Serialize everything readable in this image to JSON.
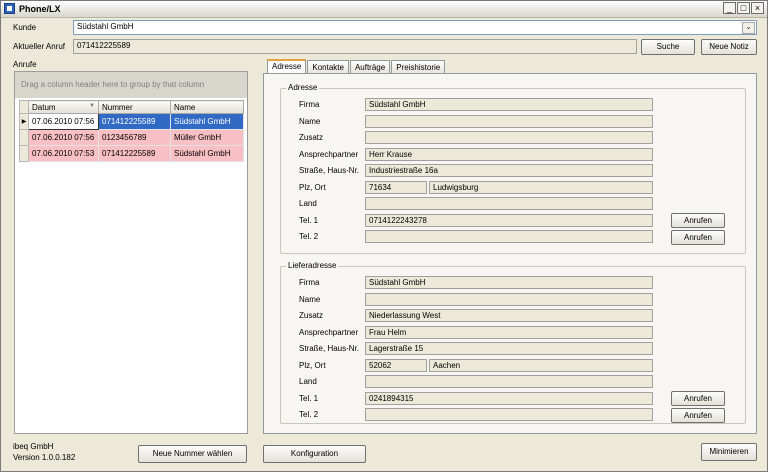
{
  "window": {
    "title": "Phone/LX",
    "min": "_",
    "max": "□",
    "close": "×"
  },
  "icons": {
    "combo_arrow": "chevron-down-icon",
    "row_indicator": "row-arrow-icon",
    "sort": "sort-desc-icon"
  },
  "top": {
    "kunde_label": "Kunde",
    "kunde_value": "Südstahl GmbH",
    "anruf_label": "Aktueller Anruf",
    "anruf_value": "071412225589",
    "suche_button": "Suche",
    "notiz_button": "Neue Notiz"
  },
  "calls": {
    "label": "Anrufe",
    "group_hint": "Drag a column header here to group by that column",
    "columns": [
      "Datum",
      "Nummer",
      "Name"
    ],
    "rows": [
      [
        "07.06.2010 07:56",
        "071412225589",
        "Südstahl GmbH"
      ],
      [
        "07.06.2010 07:56",
        "0123456789",
        "Müller GmbH"
      ],
      [
        "07.06.2010 07:53",
        "071412225589",
        "Südstahl GmbH"
      ]
    ]
  },
  "tabs": [
    "Adresse",
    "Kontakte",
    "Aufträge",
    "Preishistorie"
  ],
  "adresse": {
    "title": "Adresse",
    "firma_label": "Firma",
    "firma": "Südstahl GmbH",
    "name_label": "Name",
    "name": "",
    "zusatz_label": "Zusatz",
    "zusatz": "",
    "ansprechpartner_label": "Ansprechpartner",
    "ansprechpartner": "Herr Krause",
    "strasse_label": "Straße, Haus-Nr.",
    "strasse": "Industriestraße 16a",
    "plz_label": "Plz, Ort",
    "plz": "71634",
    "ort": "Ludwigsburg",
    "land_label": "Land",
    "land": "",
    "tel1_label": "Tel. 1",
    "tel1": "0714122243278",
    "tel2_label": "Tel. 2",
    "tel2": "",
    "anrufen": "Anrufen"
  },
  "lieferadresse": {
    "title": "Lieferadresse",
    "firma_label": "Firma",
    "firma": "Südstahl GmbH",
    "name_label": "Name",
    "name": "",
    "zusatz_label": "Zusatz",
    "zusatz": "Niederlassung West",
    "ansprechpartner_label": "Ansprechpartner",
    "ansprechpartner": "Frau Helm",
    "strasse_label": "Straße, Haus-Nr.",
    "strasse": "Lagerstraße 15",
    "plz_label": "Plz, Ort",
    "plz": "52062",
    "ort": "Aachen",
    "land_label": "Land",
    "land": "",
    "tel1_label": "Tel. 1",
    "tel1": "0241894315",
    "tel2_label": "Tel. 2",
    "tel2": "",
    "anrufen": "Anrufen"
  },
  "bottom": {
    "company": "ibeq GmbH",
    "version": "Version 1.0.0.182",
    "neue_nummer": "Neue Nummer wählen",
    "konfiguration": "Konfiguration",
    "minimieren": "Minimieren"
  },
  "colors": {
    "selected_row": "#316ac5",
    "pink_row": "#f8bfc4",
    "tab_accent": "#e6a23c"
  }
}
